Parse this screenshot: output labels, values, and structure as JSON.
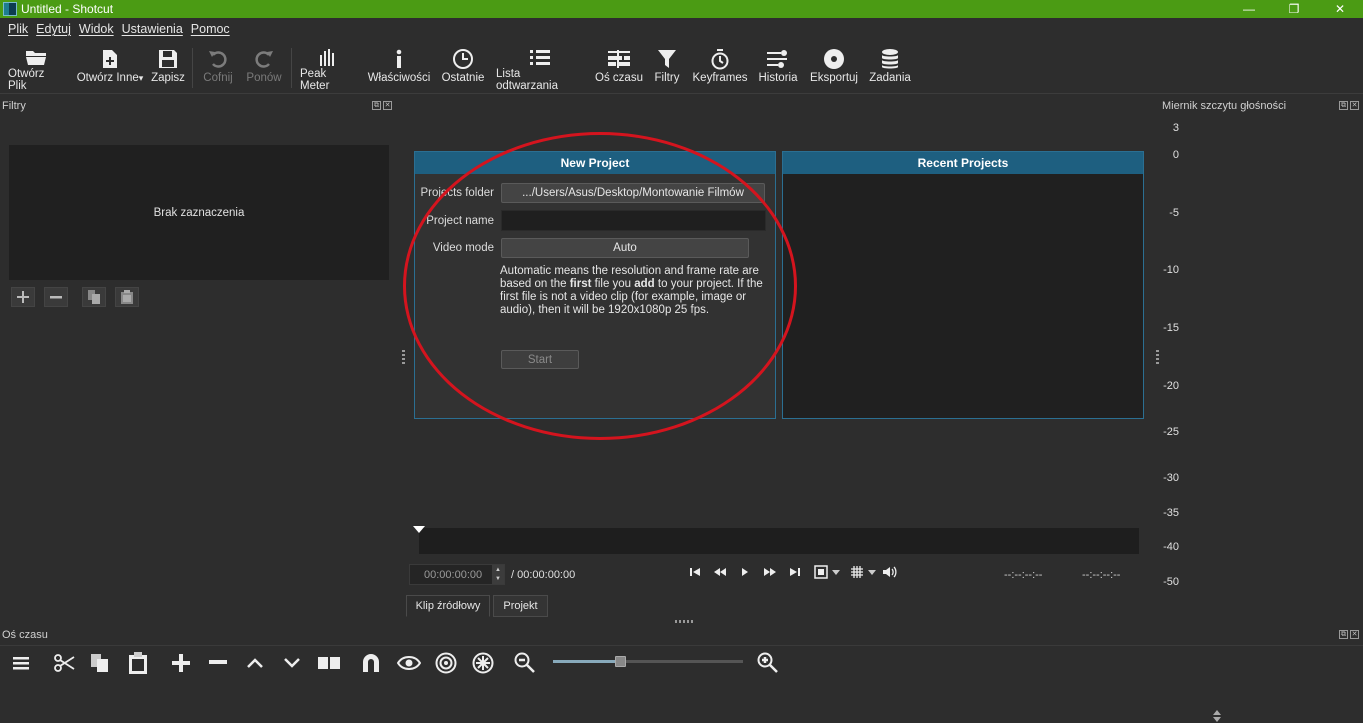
{
  "window": {
    "title": "Untitled - Shotcut",
    "controls": [
      "—",
      "❐",
      "✕"
    ]
  },
  "menu": [
    "Plik",
    "Edytuj",
    "Widok",
    "Ustawienia",
    "Pomoc"
  ],
  "toolbar": {
    "open_file": "Otwórz Plik",
    "open_other": "Otwórz Inne",
    "save": "Zapisz",
    "undo": "Cofnij",
    "redo": "Ponów",
    "peak_meter": "Peak Meter",
    "properties": "Właściwości",
    "recent": "Ostatnie",
    "playlist": "Lista odtwarzania",
    "timeline": "Oś czasu",
    "filters": "Filtry",
    "keyframes": "Keyframes",
    "history": "Historia",
    "export": "Eksportuj",
    "jobs": "Zadania"
  },
  "filters_panel": {
    "title": "Filtry",
    "empty_text": "Brak zaznaczenia"
  },
  "new_project": {
    "title": "New Project",
    "folder_label": "Projects folder",
    "folder_value": ".../Users/Asus/Desktop/Montowanie Filmów",
    "name_label": "Project name",
    "name_value": "",
    "video_mode_label": "Video mode",
    "video_mode_value": "Auto",
    "desc_1": "Automatic means the resolution and frame rate are based on the ",
    "desc_first": "first",
    "desc_2": " file you ",
    "desc_add": "add",
    "desc_3": " to your project. If the first file is not a video clip (for example, image or audio), then it will be 1920x1080p 25 fps.",
    "start_button": "Start"
  },
  "recent_projects": {
    "title": "Recent Projects"
  },
  "player": {
    "timecode": "00:00:00:00",
    "duration": "/ 00:00:00:00",
    "in_point": "--:--:--:--",
    "out_point": "--:--:--:--",
    "tab_source": "Klip źródłowy",
    "tab_project": "Projekt"
  },
  "meter": {
    "title": "Miernik szczytu głośności",
    "scale": [
      "3",
      "0",
      "-5",
      "-10",
      "-15",
      "-20",
      "-25",
      "-30",
      "-35",
      "-40",
      "-50"
    ]
  },
  "timeline": {
    "title": "Oś czasu",
    "zoom": 0.35
  },
  "colors": {
    "titlebar": "#4b9b14",
    "panel_header": "#1e5f80",
    "annotation": "#d4141e"
  }
}
